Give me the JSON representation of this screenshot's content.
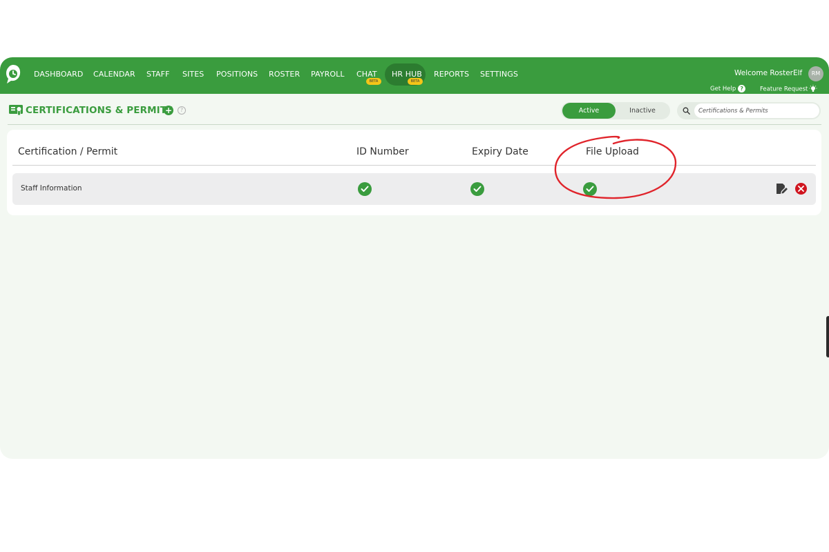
{
  "nav": {
    "items": [
      {
        "label": "DASHBOARD"
      },
      {
        "label": "CALENDAR"
      },
      {
        "label": "STAFF"
      },
      {
        "label": "SITES"
      },
      {
        "label": "POSITIONS"
      },
      {
        "label": "ROSTER"
      },
      {
        "label": "PAYROLL"
      },
      {
        "label": "CHAT",
        "badge": "BETA"
      },
      {
        "label": "HR HUB",
        "badge": "BETA",
        "active": true
      },
      {
        "label": "REPORTS"
      },
      {
        "label": "SETTINGS"
      }
    ],
    "welcome": "Welcome RosterElf",
    "avatar_initials": "RM",
    "get_help": "Get Help",
    "feature_request": "Feature Request"
  },
  "page": {
    "title": "CERTIFICATIONS & PERMITS",
    "toggle": {
      "active": "Active",
      "inactive": "Inactive",
      "selected": "Active"
    },
    "search_placeholder": "Certifications & Permits"
  },
  "table": {
    "headers": [
      "Certification / Permit",
      "ID Number",
      "Expiry Date",
      "File Upload"
    ],
    "rows": [
      {
        "name": "Staff Information",
        "id_number": true,
        "expiry_date": true,
        "file_upload": true
      }
    ]
  },
  "colors": {
    "brand_green": "#3a9c3e",
    "dark_green": "#2c7c30",
    "beta_yellow": "#f5c518",
    "delete_red": "#d0151f",
    "annotation_red": "#e0242b"
  },
  "icons": [
    "rosterelf-logo-icon",
    "certificate-icon",
    "add-icon",
    "info-icon",
    "search-icon",
    "check-icon",
    "edit-icon",
    "delete-icon",
    "lightbulb-icon",
    "help-icon"
  ]
}
